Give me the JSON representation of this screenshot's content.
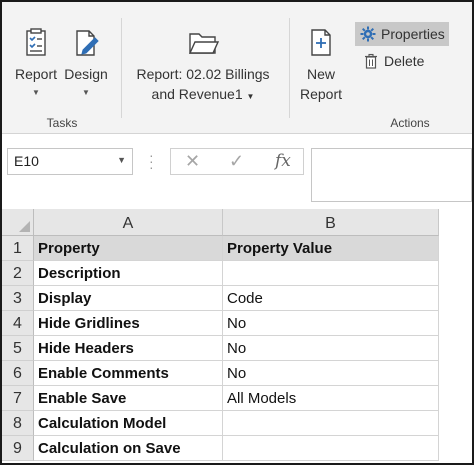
{
  "ribbon": {
    "groups": [
      {
        "label": "Tasks"
      },
      {
        "label": ""
      },
      {
        "label": "Actions"
      }
    ],
    "buttons": {
      "report": {
        "label": "Report"
      },
      "design": {
        "label": "Design"
      },
      "report_name": {
        "line1": "Report: 02.02 Billings",
        "line2": "and Revenue1"
      },
      "new_report": {
        "line1": "New",
        "line2": "Report"
      },
      "properties": {
        "label": "Properties"
      },
      "delete": {
        "label": "Delete"
      }
    }
  },
  "formula_bar": {
    "name_box": "E10",
    "fx_label": "fx"
  },
  "sheet": {
    "columns": [
      "A",
      "B"
    ],
    "rows": [
      {
        "num": "1",
        "a": "Property",
        "b": "Property Value"
      },
      {
        "num": "2",
        "a": "Description",
        "b": ""
      },
      {
        "num": "3",
        "a": "Display",
        "b": "Code"
      },
      {
        "num": "4",
        "a": "Hide Gridlines",
        "b": "No"
      },
      {
        "num": "5",
        "a": "Hide Headers",
        "b": "No"
      },
      {
        "num": "6",
        "a": "Enable Comments",
        "b": "No"
      },
      {
        "num": "7",
        "a": "Enable Save",
        "b": "All Models"
      },
      {
        "num": "8",
        "a": "Calculation Model",
        "b": ""
      },
      {
        "num": "9",
        "a": "Calculation on Save",
        "b": ""
      }
    ]
  },
  "colors": {
    "ribbon_bg": "#f3f3f3",
    "header_bg": "#e6e6e6",
    "property_header_bg": "#d9d9d9",
    "active_button_bg": "#c8c8c8",
    "icon_blue": "#2f6eb5"
  }
}
